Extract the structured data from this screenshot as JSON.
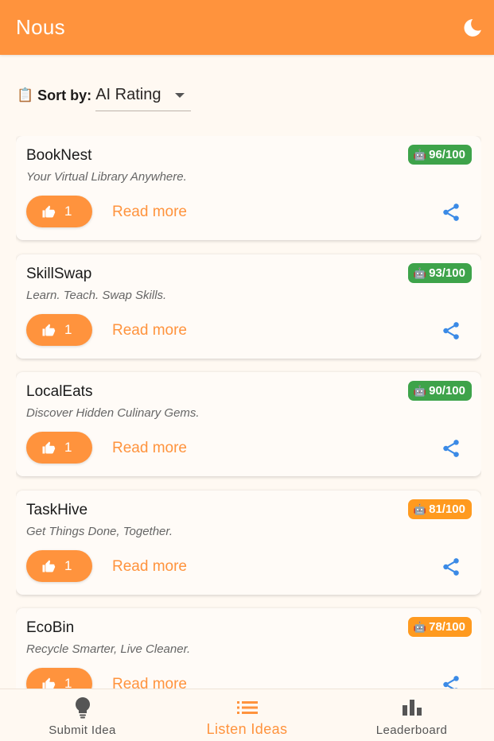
{
  "app": {
    "title": "Nous",
    "theme_toggle_icon": "moon-icon",
    "accent": "#ff933d"
  },
  "sort": {
    "icon": "📋",
    "label": "Sort by:",
    "value": "AI Rating"
  },
  "ideas": [
    {
      "title": "BookNest",
      "tagline": "Your Virtual Library Anywhere.",
      "rating": "96/100",
      "rating_color": "#3ea34a",
      "votes": "1",
      "read_more": "Read more"
    },
    {
      "title": "SkillSwap",
      "tagline": "Learn. Teach. Swap Skills.",
      "rating": "93/100",
      "rating_color": "#3ea34a",
      "votes": "1",
      "read_more": "Read more"
    },
    {
      "title": "LocalEats",
      "tagline": "Discover Hidden Culinary Gems.",
      "rating": "90/100",
      "rating_color": "#3ea34a",
      "votes": "1",
      "read_more": "Read more"
    },
    {
      "title": "TaskHive",
      "tagline": "Get Things Done, Together.",
      "rating": "81/100",
      "rating_color": "#ff9a1f",
      "votes": "1",
      "read_more": "Read more"
    },
    {
      "title": "EcoBin",
      "tagline": "Recycle Smarter, Live Cleaner.",
      "rating": "78/100",
      "rating_color": "#ff9a1f",
      "votes": "1",
      "read_more": "Read more"
    }
  ],
  "nav": {
    "items": [
      {
        "label": "Submit Idea",
        "icon": "lightbulb-icon"
      },
      {
        "label": "Listen Ideas",
        "icon": "list-icon",
        "active": true
      },
      {
        "label": "Leaderboard",
        "icon": "bar-chart-icon"
      }
    ]
  }
}
